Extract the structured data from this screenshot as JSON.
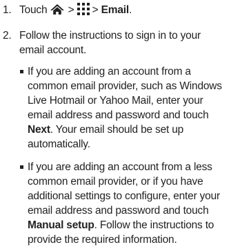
{
  "steps": [
    {
      "number": "1.",
      "prefix": "Touch",
      "icons": [
        "home-icon",
        "apps-grid-icon"
      ],
      "sep1": ">",
      "sep2": ">",
      "target": "Email",
      "end": "."
    },
    {
      "number": "2.",
      "text": "Follow the instructions to sign in to your email account.",
      "bullets": [
        {
          "text_before": "If you are adding an account from a common email provider, such as Windows Live Hotmail or Yahoo Mail, enter your email address and password and touch ",
          "bold": "Next",
          "text_after": ". Your email should be set up automatically."
        },
        {
          "text_before": "If you are adding an account from a less common email provider, or if you have additional settings to configure, enter your email address and password and touch ",
          "bold": "Manual setup",
          "text_after": ". Follow the instructions to provide the required information."
        }
      ]
    }
  ],
  "colors": {
    "text": "#222222",
    "background": "#ffffff"
  }
}
